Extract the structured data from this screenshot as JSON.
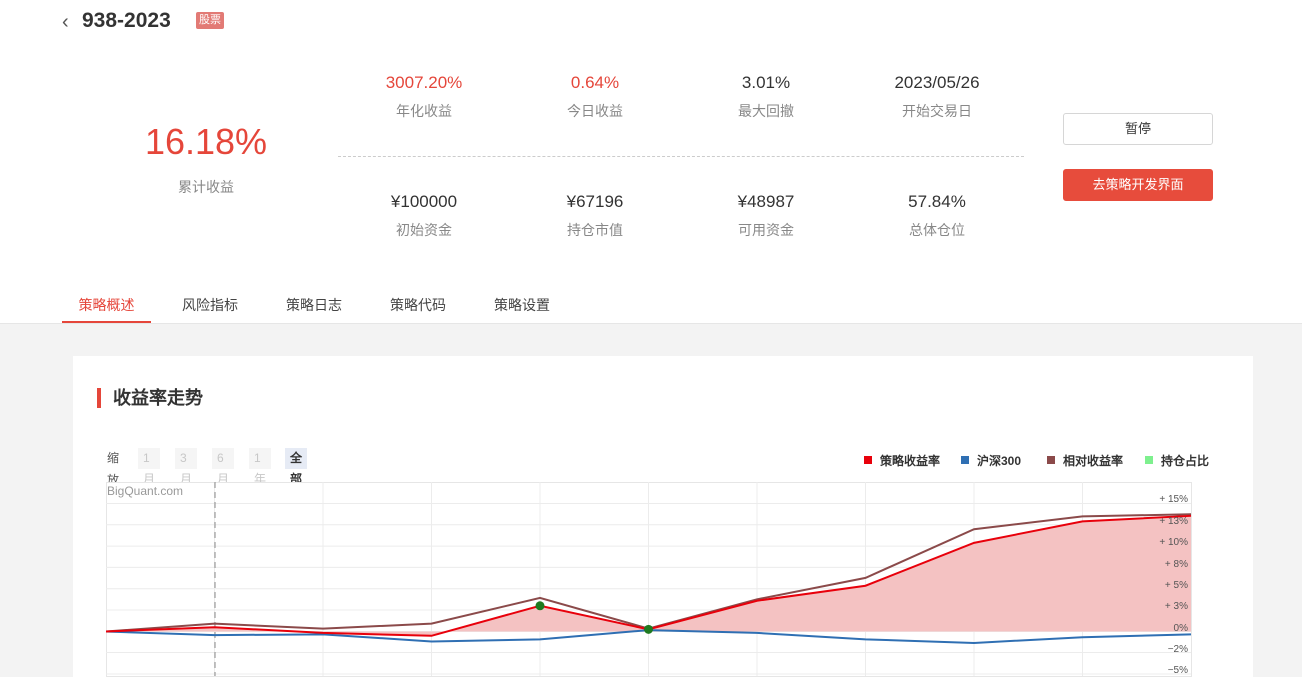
{
  "header": {
    "back_icon": "chevron-left-icon",
    "title": "938-2023",
    "badge": "股票"
  },
  "summary": {
    "cumulative_return": {
      "value": "16.18%",
      "label": "累计收益"
    },
    "stats_top": [
      {
        "value": "3007.20%",
        "label": "年化收益",
        "highlight": true
      },
      {
        "value": "0.64%",
        "label": "今日收益",
        "highlight": true
      },
      {
        "value": "3.01%",
        "label": "最大回撤",
        "highlight": false
      },
      {
        "value": "2023/05/26",
        "label": "开始交易日",
        "highlight": false
      }
    ],
    "stats_bottom": [
      {
        "value": "¥100000",
        "label": "初始资金"
      },
      {
        "value": "¥67196",
        "label": "持仓市值"
      },
      {
        "value": "¥48987",
        "label": "可用资金"
      },
      {
        "value": "57.84%",
        "label": "总体仓位"
      }
    ]
  },
  "actions": {
    "pause_label": "暂停",
    "dev_label": "去策略开发界面"
  },
  "tabs": [
    {
      "label": "策略概述",
      "active": true
    },
    {
      "label": "风险指标",
      "active": false
    },
    {
      "label": "策略日志",
      "active": false
    },
    {
      "label": "策略代码",
      "active": false
    },
    {
      "label": "策略设置",
      "active": false
    }
  ],
  "panel": {
    "title": "收益率走势",
    "zoom_label": "缩放",
    "zoom_options": [
      {
        "label": "1月",
        "active": false
      },
      {
        "label": "3月",
        "active": false
      },
      {
        "label": "6月",
        "active": false
      },
      {
        "label": "1年",
        "active": false
      },
      {
        "label": "全部",
        "active": true
      }
    ],
    "watermark": "BigQuant.com"
  },
  "colors": {
    "accent": "#e5463a",
    "strategy": "#e8000b",
    "benchmark": "#2f6fb3",
    "relative": "#8b4a4a",
    "position": "#7ef08e",
    "marker": "#1f7a1f"
  },
  "chart_data": {
    "type": "line",
    "title": "",
    "xlabel": "",
    "ylabel": "",
    "x": [
      0,
      1,
      2,
      3,
      4,
      5,
      6,
      7,
      8,
      9,
      10
    ],
    "series": [
      {
        "name": "策略收益率",
        "values": [
          0,
          0.6,
          -0.2,
          -0.6,
          3.6,
          0.3,
          4.3,
          6.4,
          12.4,
          15.4,
          16.18
        ],
        "area": true
      },
      {
        "name": "沪深300",
        "values": [
          0,
          -0.5,
          -0.4,
          -1.4,
          -1.1,
          0.2,
          -0.2,
          -1.1,
          -1.6,
          -0.8,
          -0.4
        ]
      },
      {
        "name": "相对收益率",
        "values": [
          0,
          1.1,
          0.4,
          1.1,
          4.7,
          0.4,
          4.5,
          7.5,
          14.3,
          16.1,
          16.4
        ]
      },
      {
        "name": "持仓占比",
        "values": []
      }
    ],
    "markers": [
      {
        "series": "策略收益率",
        "x": 4,
        "y": 3.6
      },
      {
        "series": "策略收益率",
        "x": 5,
        "y": 0.3
      }
    ],
    "y_ticks": [
      "15%",
      "13%",
      "10%",
      "8%",
      "5%",
      "3%",
      "0%",
      "-2%",
      "-5%"
    ],
    "ylim": [
      -5,
      16
    ],
    "grid": true,
    "legend_position": "top-right"
  }
}
